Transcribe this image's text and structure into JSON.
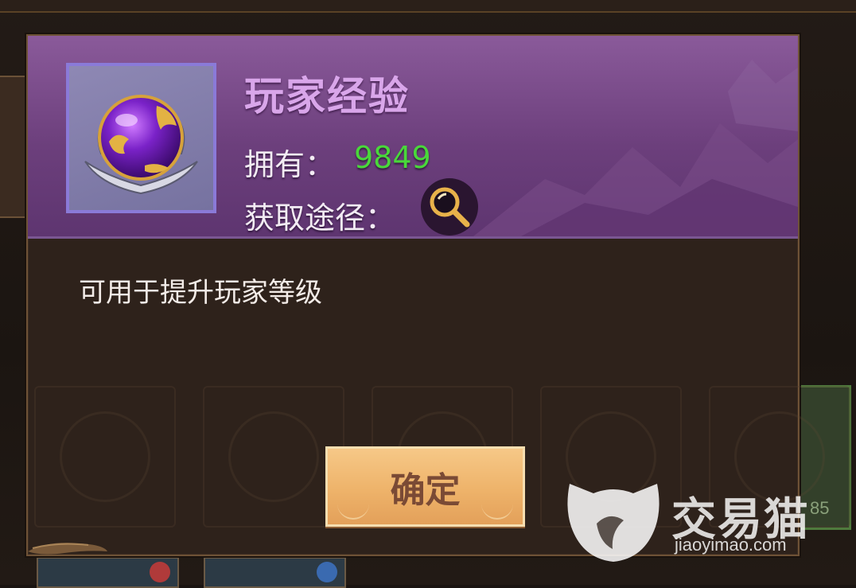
{
  "item": {
    "name": "玩家经验",
    "owned_label": "拥有：",
    "owned_value": "9849",
    "source_label": "获取途径：",
    "description": "可用于提升玩家等级",
    "icon": "purple-orb-icon"
  },
  "actions": {
    "confirm_label": "确定",
    "search_icon": "magnifier-icon"
  },
  "background": {
    "card_level": "85"
  },
  "watermark": {
    "brand": "交易猫",
    "url": "jiaoyimao.com"
  },
  "colors": {
    "header_purple": "#6c3f7c",
    "title_purple": "#d9a6ea",
    "owned_green": "#49d83a",
    "button_orange": "#eeb36a",
    "dialog_brown": "#2e221b"
  }
}
